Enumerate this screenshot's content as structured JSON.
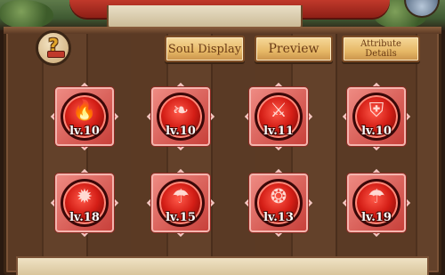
{
  "toolbar": {
    "help_icon": "help-book-icon",
    "soul_display_label": "Soul Display",
    "preview_label": "Preview",
    "attribute_details_label": "Attribute Details"
  },
  "souls": [
    {
      "icon": "flame-icon",
      "level": "lv.10"
    },
    {
      "icon": "feather-icon",
      "level": "lv.10"
    },
    {
      "icon": "sword-icon",
      "level": "lv.11"
    },
    {
      "icon": "armor-icon",
      "level": "lv.10"
    },
    {
      "icon": "burst-icon",
      "level": "lv.18"
    },
    {
      "icon": "mushroom-icon",
      "level": "lv.15"
    },
    {
      "icon": "spiky-creature-icon",
      "level": "lv.13"
    },
    {
      "icon": "mushroom-icon",
      "level": "lv.19"
    }
  ],
  "colors": {
    "slot_red": "#d41e16",
    "button_gold": "#e6b866",
    "wood": "#5b3a24"
  }
}
